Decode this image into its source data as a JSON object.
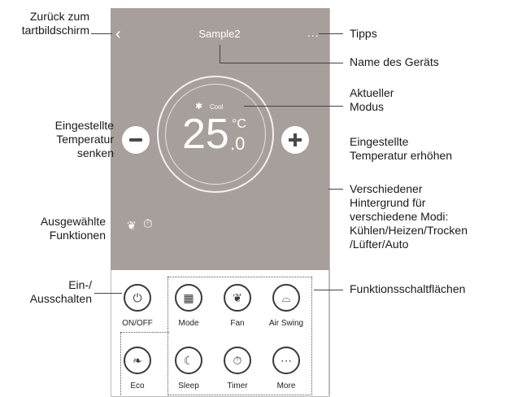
{
  "device": {
    "name": "Sample2",
    "mode": "Cool",
    "temperature_int": "25",
    "temperature_unit": "°C",
    "temperature_dec": ".0",
    "more_dots": "..."
  },
  "functions": [
    {
      "label": "ON/OFF",
      "icon": "power-icon"
    },
    {
      "label": "Mode",
      "icon": "mode-grid-icon"
    },
    {
      "label": "Fan",
      "icon": "fan-icon"
    },
    {
      "label": "Air Swing",
      "icon": "air-swing-icon"
    },
    {
      "label": "Eco",
      "icon": "leaf-icon"
    },
    {
      "label": "Sleep",
      "icon": "moon-icon"
    },
    {
      "label": "Timer",
      "icon": "timer-icon"
    },
    {
      "label": "More",
      "icon": "more-icon"
    }
  ],
  "annotations": {
    "back_line1": "Zurück zum",
    "back_line2": "tartbildschirm",
    "tips": "Tipps",
    "device_name": "Name des Geräts",
    "current_mode_line1": "Aktueller",
    "current_mode_line2": "Modus",
    "temp_down_line1": "Eingestellte",
    "temp_down_line2": "Temperatur",
    "temp_down_line3": "senken",
    "temp_up_line1": "Eingestellte",
    "temp_up_line2": "Temperatur erhöhen",
    "bg_line1": "Verschiedener",
    "bg_line2": "Hintergrund für",
    "bg_line3": "verschiedene Modi:",
    "bg_line4": "Kühlen/Heizen/Trocken",
    "bg_line5": "/Lüfter/Auto",
    "selected_line1": "Ausgewählte",
    "selected_line2": "Funktionen",
    "onoff_line1": "Ein-/",
    "onoff_line2": "Ausschalten",
    "function_buttons": "Funktionsschaltflächen"
  }
}
